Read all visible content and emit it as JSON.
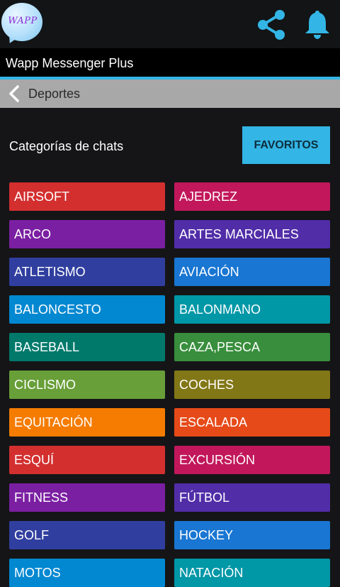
{
  "header": {
    "logo_text": "WAPP",
    "icons": [
      "share-icon",
      "bell-icon"
    ],
    "accent_color": "#33b5e5"
  },
  "app": {
    "title": "Wapp Messenger Plus"
  },
  "breadcrumb": {
    "label": "Deportes"
  },
  "section": {
    "label": "Categorías de chats",
    "favorites_button": "FAVORITOS"
  },
  "categories": [
    {
      "label": "AIRSOFT",
      "color": "#d32f2f"
    },
    {
      "label": "AJEDREZ",
      "color": "#c2185b"
    },
    {
      "label": "ARCO",
      "color": "#7b1fa2"
    },
    {
      "label": "ARTES MARCIALES",
      "color": "#512da8"
    },
    {
      "label": "ATLETISMO",
      "color": "#303f9f"
    },
    {
      "label": "AVIACIÓN",
      "color": "#1976d2"
    },
    {
      "label": "BALONCESTO",
      "color": "#0288d1"
    },
    {
      "label": "BALONMANO",
      "color": "#0097a7"
    },
    {
      "label": "BASEBALL",
      "color": "#00796b"
    },
    {
      "label": "CAZA,PESCA",
      "color": "#388e3c"
    },
    {
      "label": "CICLISMO",
      "color": "#689f38"
    },
    {
      "label": "COCHES",
      "color": "#827717"
    },
    {
      "label": "EQUITACIÓN",
      "color": "#f57c00"
    },
    {
      "label": "ESCALADA",
      "color": "#e64a19"
    },
    {
      "label": "ESQUÍ",
      "color": "#d32f2f"
    },
    {
      "label": "EXCURSIÓN",
      "color": "#c2185b"
    },
    {
      "label": "FITNESS",
      "color": "#7b1fa2"
    },
    {
      "label": "FÚTBOL",
      "color": "#512da8"
    },
    {
      "label": "GOLF",
      "color": "#303f9f"
    },
    {
      "label": "HOCKEY",
      "color": "#1976d2"
    },
    {
      "label": "MOTOS",
      "color": "#0288d1"
    },
    {
      "label": "NATACIÓN",
      "color": "#0097a7"
    }
  ]
}
